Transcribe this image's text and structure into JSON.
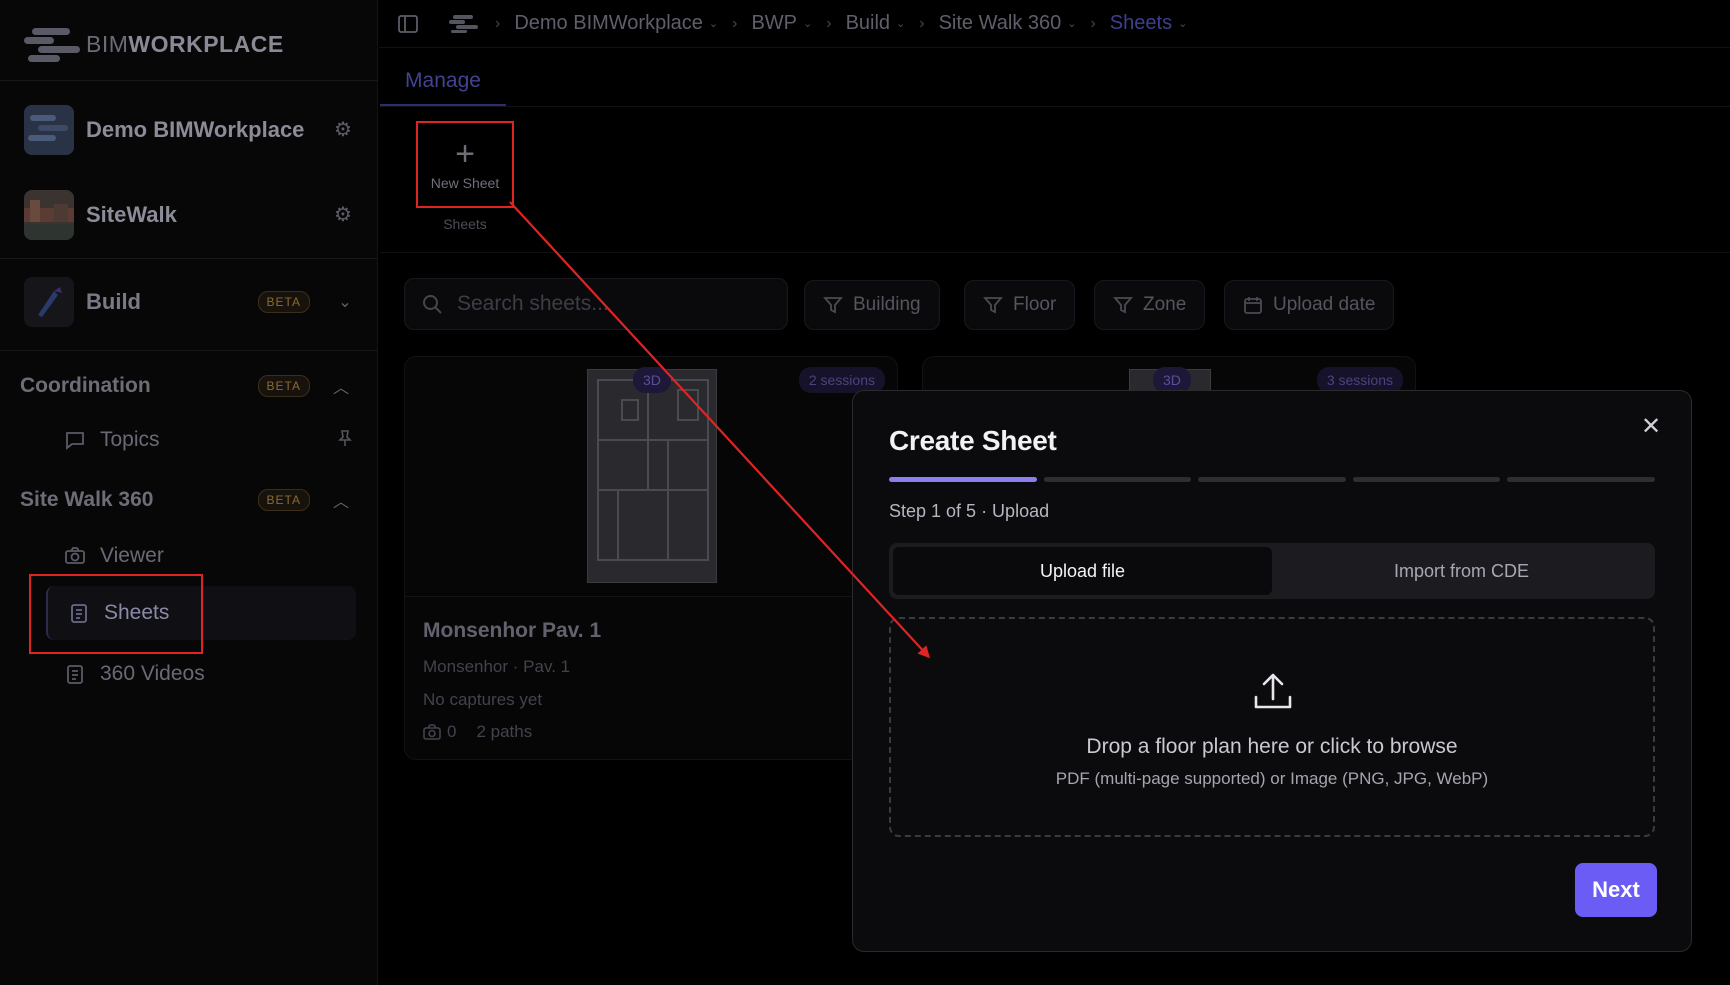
{
  "app": {
    "logo_light": "BIM",
    "logo_bold": "WORKPLACE"
  },
  "sidebar": {
    "workspaces": [
      {
        "name": "Demo BIMWorkplace"
      },
      {
        "name": "SiteWalk"
      }
    ],
    "build": {
      "label": "Build",
      "badge": "BETA"
    },
    "coordination": {
      "label": "Coordination",
      "badge": "BETA",
      "items": [
        {
          "label": "Topics"
        }
      ]
    },
    "site_walk": {
      "label": "Site Walk 360",
      "badge": "BETA",
      "items": [
        {
          "label": "Viewer"
        },
        {
          "label": "Sheets"
        },
        {
          "label": "360 Videos"
        }
      ]
    }
  },
  "breadcrumb": {
    "items": [
      "Demo BIMWorkplace",
      "BWP",
      "Build",
      "Site Walk 360",
      "Sheets"
    ]
  },
  "tabs": {
    "manage": "Manage"
  },
  "toolbar": {
    "new_sheet": "New Sheet",
    "group_caption": "Sheets"
  },
  "filters": {
    "search_placeholder": "Search sheets...",
    "building": "Building",
    "floor": "Floor",
    "zone": "Zone",
    "upload_date": "Upload date"
  },
  "cards": [
    {
      "badge": "3D",
      "sessions": "2 sessions",
      "title": "Monsenhor Pav. 1",
      "subtitle": "Monsenhor · Pav. 1",
      "status": "No captures yet",
      "captures": "0",
      "paths": "2 paths"
    },
    {
      "badge": "3D",
      "sessions": "3 sessions"
    }
  ],
  "modal": {
    "title": "Create Sheet",
    "step_text": "Step 1 of 5 · Upload",
    "steps_total": 5,
    "steps_done": 1,
    "tab_upload": "Upload file",
    "tab_import": "Import from CDE",
    "drop_title": "Drop a floor plan here or click to browse",
    "drop_hint": "PDF (multi-page supported) or Image (PNG, JPG, WebP)",
    "next": "Next"
  },
  "colors": {
    "accent": "#6b5cf6",
    "annotation": "#e02424"
  }
}
